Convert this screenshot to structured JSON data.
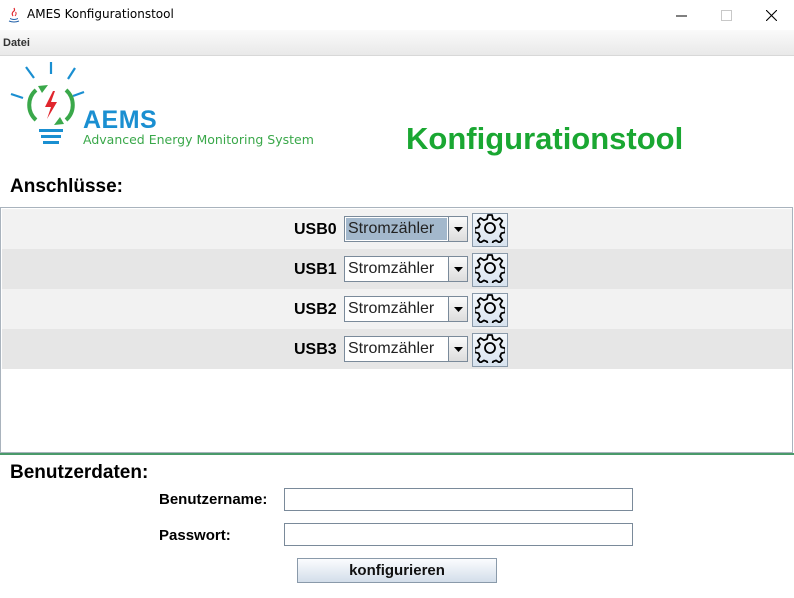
{
  "window": {
    "title": "AMES Konfigurationstool",
    "minimize_glyph": "—",
    "maximize_glyph": "☐",
    "close_glyph": "✕"
  },
  "menu": {
    "items": [
      {
        "label": "Datei"
      }
    ]
  },
  "logo": {
    "title": "AEMS",
    "subtitle": "Advanced Energy Monitoring System"
  },
  "header": {
    "title": "Konfigurationstool"
  },
  "ports": {
    "heading": "Anschlüsse:",
    "rows": [
      {
        "label": "USB0",
        "value": "Stromzähler",
        "selected": true
      },
      {
        "label": "USB1",
        "value": "Stromzähler",
        "selected": false
      },
      {
        "label": "USB2",
        "value": "Stromzähler",
        "selected": false
      },
      {
        "label": "USB3",
        "value": "Stromzähler",
        "selected": false
      }
    ]
  },
  "credentials": {
    "heading": "Benutzerdaten:",
    "username_label": "Benutzername:",
    "username_value": "",
    "password_label": "Passwort:",
    "password_value": ""
  },
  "actions": {
    "configure_label": "konfigurieren"
  },
  "colors": {
    "accent_green": "#1aa732",
    "logo_blue": "#1a8fd1",
    "combo_selection": "#a3b8cc",
    "row_alt": "#e6e6e6"
  },
  "icons": [
    "java-app-icon",
    "lightbulb-logo-icon",
    "chevron-down-icon",
    "gear-icon"
  ]
}
